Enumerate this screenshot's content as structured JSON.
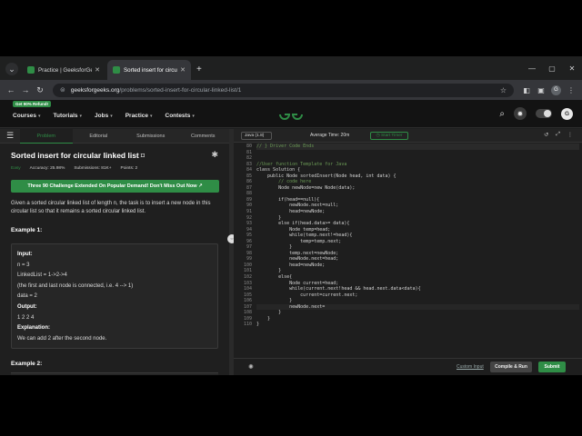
{
  "browser": {
    "tabs": [
      {
        "title": "Practice | GeeksforGeeks | A c",
        "active": false
      },
      {
        "title": "Sorted insert for circular linked li",
        "active": true
      }
    ],
    "url_domain": "geeksforgeeks.org",
    "url_path": "/problems/sorted-insert-for-circular-linked-list/1",
    "profile_initial": "G"
  },
  "header": {
    "promo": "Get 90% Refund!",
    "nav": [
      "Courses",
      "Tutorials",
      "Jobs",
      "Practice",
      "Contests"
    ],
    "avatar": "G"
  },
  "left_panel": {
    "tabs": [
      "Problem",
      "Editorial",
      "Submissions",
      "Comments"
    ],
    "title": "Sorted insert for circular linked list",
    "difficulty": "Easy",
    "accuracy": "Accuracy: 25.98%",
    "submissions": "Submissions: 81K+",
    "points": "Points: 2",
    "banner": "Three 90 Challenge Extended On Popular Demand! Don't Miss Out Now",
    "description": "Given a sorted circular linked list of length n, the task is to insert a new node in this circular list so that it remains a sorted circular linked list.",
    "example1_heading": "Example 1:",
    "example1": {
      "input_label": "Input:",
      "line1": "n = 3",
      "line2": "LinkedList = 1->2->4",
      "line3": "(the first and last node is connected, i.e. 4 --> 1)",
      "line4": "data = 2",
      "output_label": "Output:",
      "output": "1 2 2 4",
      "explanation_label": "Explanation:",
      "explanation": "We can add 2 after the second node."
    },
    "example2_heading": "Example 2:"
  },
  "editor": {
    "language": "Java (1.8)",
    "avg_time": "Average Time: 20m",
    "start_timer": "Start Timer",
    "line_numbers": [
      "80",
      "81",
      "82",
      "83",
      "84",
      "85",
      "86",
      "87",
      "88",
      "89",
      "90",
      "91",
      "92",
      "93",
      "94",
      "95",
      "96",
      "97",
      "98",
      "99",
      "100",
      "101",
      "102",
      "103",
      "104",
      "105",
      "106",
      "107",
      "108",
      "109",
      "110"
    ],
    "code_lines": [
      "// } Driver Code Ends",
      "",
      "",
      "//User function Template for Java",
      "class Solution {",
      "    public Node sortedInsert(Node head, int data) {",
      "        // code here",
      "        Node newNode=new Node(data);",
      "",
      "        if(head==null){",
      "            newNode.next=null;",
      "            head=newNode;",
      "        }",
      "        else if(head.data>= data){",
      "            Node temp=head;",
      "            while(temp.next!=head){",
      "                temp=temp.next;",
      "            }",
      "            temp.next=newNode;",
      "            newNode.next=head;",
      "            head=newNode;",
      "        }",
      "        else{",
      "            Node current=head;",
      "            while(current.next!head && head.next.data<data){",
      "                current=current.next;",
      "            }",
      "            newNode.next=",
      "        }",
      "    }",
      "}"
    ],
    "custom_input": "Custom Input",
    "compile_run": "Compile & Run",
    "submit": "Submit"
  }
}
